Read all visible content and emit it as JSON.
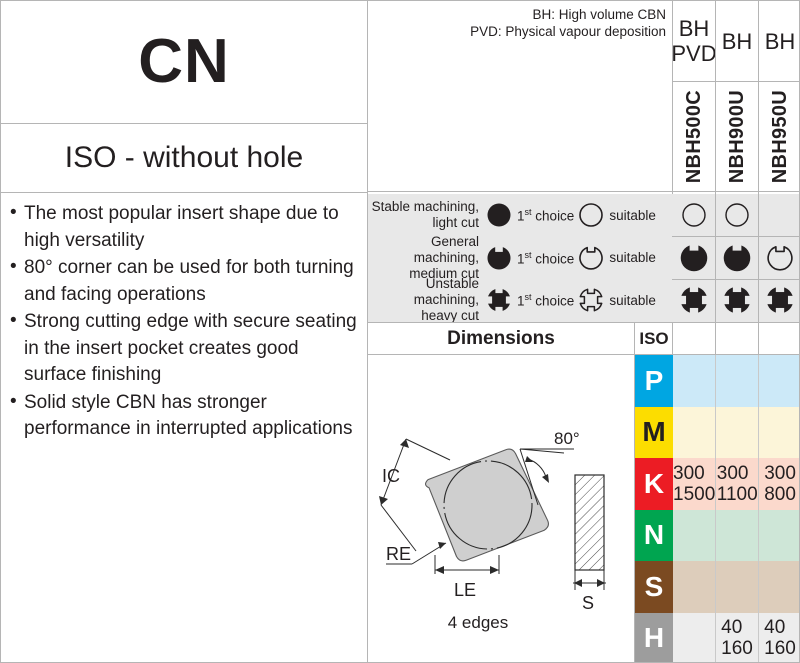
{
  "left": {
    "shape_code": "CN",
    "iso_subtitle": "ISO - without hole",
    "bullets": [
      "The most popular insert shape due to high versatility",
      "80° corner can be used for both turning and facing operations",
      "Strong cutting edge with secure seating in the insert pocket creates good surface finishing",
      "Solid style CBN has stronger performance in interrupted applications"
    ]
  },
  "note": {
    "line1": "BH: High volume CBN",
    "line2": "PVD: Physical vapour deposition"
  },
  "grades": [
    {
      "type_line1": "BH",
      "type_line2": "PVD",
      "name": "NBH500C"
    },
    {
      "type_line1": "BH",
      "type_line2": "",
      "name": "NBH900U"
    },
    {
      "type_line1": "BH",
      "type_line2": "",
      "name": "NBH950U"
    }
  ],
  "legend": {
    "first_choice": "choice",
    "first_prefix": "1",
    "first_sup": "st",
    "suitable": "suitable"
  },
  "conditions": [
    {
      "label_line1": "Stable machining,",
      "label_line2": "light cut",
      "symbol": "circle",
      "ratings": [
        "suitable",
        "suitable",
        "none"
      ]
    },
    {
      "label_line1": "General machining,",
      "label_line2": "medium cut",
      "symbol": "notch1",
      "ratings": [
        "first",
        "first",
        "suitable"
      ]
    },
    {
      "label_line1": "Unstable machining,",
      "label_line2": "heavy cut",
      "symbol": "notch4",
      "ratings": [
        "first",
        "first",
        "first"
      ]
    }
  ],
  "dimensions": {
    "header": "Dimensions",
    "iso_header": "ISO",
    "labels": {
      "ic": "IC",
      "re": "RE",
      "le": "LE",
      "s": "S",
      "angle": "80°",
      "edges": "4 edges"
    }
  },
  "iso_table": {
    "rows": [
      {
        "code": "P",
        "badge_color": "#00a6e2",
        "badge_text_color": "#ffffff",
        "cell_color": "#cce9f8",
        "values": [
          "",
          "",
          ""
        ]
      },
      {
        "code": "M",
        "badge_color": "#fcdd00",
        "badge_text_color": "#231f20",
        "cell_color": "#fcf5d9",
        "values": [
          "",
          "",
          ""
        ]
      },
      {
        "code": "K",
        "badge_color": "#ec1c24",
        "badge_text_color": "#ffffff",
        "cell_color": "#fbd9cc",
        "values": [
          "300\n1500",
          "300\n1100",
          "300\n800"
        ]
      },
      {
        "code": "N",
        "badge_color": "#00a550",
        "badge_text_color": "#ffffff",
        "cell_color": "#cee6d7",
        "values": [
          "",
          "",
          ""
        ]
      },
      {
        "code": "S",
        "badge_color": "#7b4a21",
        "badge_text_color": "#ffffff",
        "cell_color": "#ddcdbb",
        "values": [
          "",
          "",
          ""
        ]
      },
      {
        "code": "H",
        "badge_color": "#9d9d9d",
        "badge_text_color": "#ffffff",
        "cell_color": "#ededed",
        "values": [
          "",
          "40\n160",
          "40\n160"
        ]
      }
    ]
  }
}
